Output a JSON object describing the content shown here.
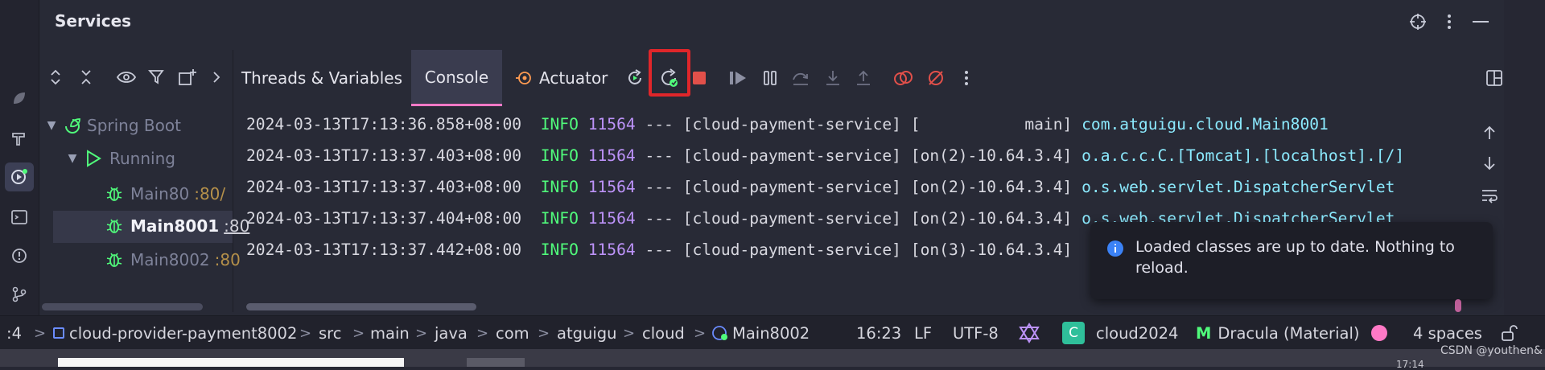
{
  "panel": {
    "title": "Services"
  },
  "toolbar_tabs": {
    "threads": "Threads & Variables",
    "console": "Console",
    "actuator": "Actuator"
  },
  "tree": {
    "spring_boot": "Spring Boot",
    "running": "Running",
    "items": [
      {
        "name": "Main80",
        "port": ":80/"
      },
      {
        "name": "Main8001",
        "port": ":80"
      },
      {
        "name": "Main8002",
        "port": ":80"
      }
    ]
  },
  "console": {
    "lines": [
      {
        "time": "2024-03-13T17:13:36.858+08:00",
        "level": "INFO",
        "pid": "11564",
        "sep": "---",
        "app": "[cloud-payment-service]",
        "thread": "[           main]",
        "logger": "com.atguigu.cloud.Main8001"
      },
      {
        "time": "2024-03-13T17:13:37.403+08:00",
        "level": "INFO",
        "pid": "11564",
        "sep": "---",
        "app": "[cloud-payment-service]",
        "thread": "[on(2)-10.64.3.4]",
        "logger": "o.a.c.c.C.[Tomcat].[localhost].[/]"
      },
      {
        "time": "2024-03-13T17:13:37.403+08:00",
        "level": "INFO",
        "pid": "11564",
        "sep": "---",
        "app": "[cloud-payment-service]",
        "thread": "[on(2)-10.64.3.4]",
        "logger": "o.s.web.servlet.DispatcherServlet"
      },
      {
        "time": "2024-03-13T17:13:37.404+08:00",
        "level": "INFO",
        "pid": "11564",
        "sep": "---",
        "app": "[cloud-payment-service]",
        "thread": "[on(2)-10.64.3.4]",
        "logger": "o.s.web.servlet.DispatcherServlet"
      },
      {
        "time": "2024-03-13T17:13:37.442+08:00",
        "level": "INFO",
        "pid": "11564",
        "sep": "---",
        "app": "[cloud-payment-service]",
        "thread": "[on(3)-10.64.3.4]",
        "logger": ""
      }
    ]
  },
  "notification": {
    "message": "Loaded classes are up to date. Nothing to reload."
  },
  "statusbar": {
    "crumb_prefix": ":4",
    "module": "cloud-provider-payment8002",
    "path": [
      "src",
      "main",
      "java",
      "com",
      "atguigu",
      "cloud"
    ],
    "file": "Main8002",
    "position": "16:23",
    "line_sep": "LF",
    "encoding": "UTF-8",
    "project_badge": "C",
    "project": "cloud2024",
    "theme": "Dracula (Material)",
    "indent": "4 spaces"
  },
  "watermark": "CSDN @youthen&",
  "clock": "17:14",
  "colors": {
    "bg": "#282a36",
    "pink": "#ff79c6",
    "green": "#50fa7b",
    "purple": "#bd93f9",
    "cyan": "#8be9fd",
    "highlight": "#e0262a"
  }
}
